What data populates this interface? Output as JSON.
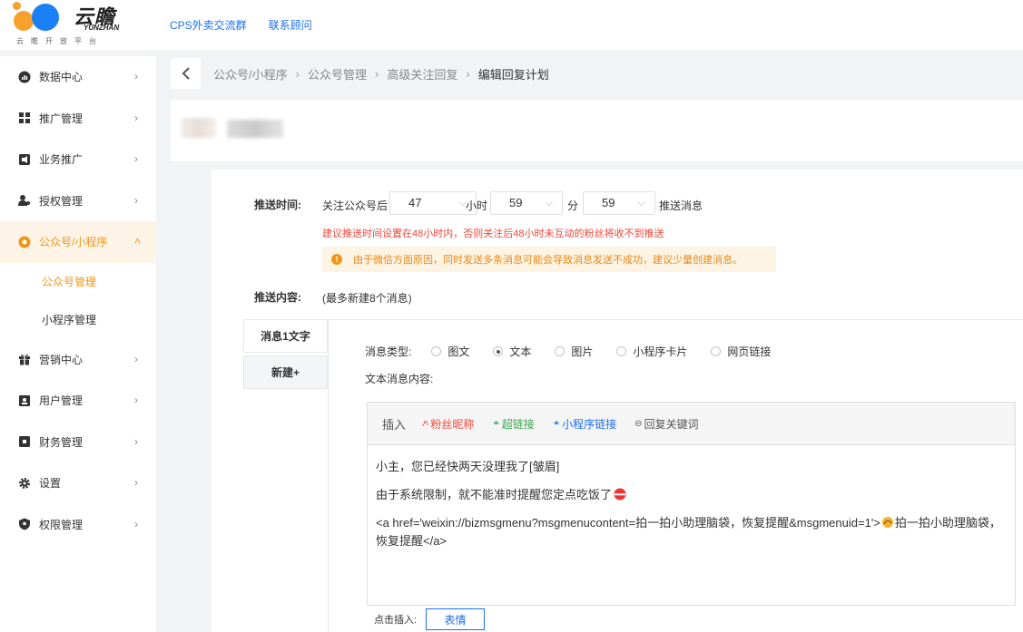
{
  "brand": {
    "name": "云瞻",
    "name_en": "YUNZHAN",
    "slogan": "云瞻开放平台"
  },
  "top_links": [
    "CPS外卖交流群",
    "联系顾问"
  ],
  "sidebar": {
    "items": [
      {
        "label": "数据中心",
        "icon": "chart-icon"
      },
      {
        "label": "推广管理",
        "icon": "grid-icon"
      },
      {
        "label": "业务推广",
        "icon": "megaphone-icon"
      },
      {
        "label": "授权管理",
        "icon": "user-key-icon"
      },
      {
        "label": "公众号/小程序",
        "icon": "wechat-circle-icon"
      },
      {
        "label": "营销中心",
        "icon": "gift-icon"
      },
      {
        "label": "用户管理",
        "icon": "user-card-icon"
      },
      {
        "label": "财务管理",
        "icon": "wallet-icon"
      },
      {
        "label": "设置",
        "icon": "gear-icon"
      },
      {
        "label": "权限管理",
        "icon": "shield-icon"
      }
    ],
    "subitems": [
      "公众号管理",
      "小程序管理"
    ]
  },
  "breadcrumb": [
    "公众号/小程序",
    "公众号管理",
    "高级关注回复",
    "编辑回复计划"
  ],
  "form": {
    "push_time_label": "推送时间:",
    "prefix": "关注公众号后",
    "hours": "47",
    "hours_unit": "小时",
    "minutes": "59",
    "minutes_unit": "分",
    "seconds": "59",
    "suffix": "推送消息",
    "red_tip": "建议推送时间设置在48小时内，否则关注后48小时未互动的粉丝将收不到推送",
    "notice": "由于微信方面原因，同时发送多条消息可能会导致消息发送不成功，建议少量创建消息。",
    "content_label": "推送内容:",
    "content_hint": "(最多新建8个消息)"
  },
  "tabs": [
    "消息1文字",
    "新建+"
  ],
  "message": {
    "type_label": "消息类型:",
    "types": [
      "图文",
      "文本",
      "图片",
      "小程序卡片",
      "网页链接"
    ],
    "selected_type": "文本",
    "text_label": "文本消息内容:"
  },
  "toolbar": {
    "insert": "插入",
    "fan_nickname": "粉丝昵称",
    "hyperlink": "超链接",
    "mini_link": "小程序链接",
    "reply_keyword": "回复关键词"
  },
  "editor": {
    "line1": "小主，您已经快两天没理我了[皱眉]",
    "line2": "由于系统限制，就不能准时提醒您定点吃饭了",
    "line3a": "<a href='weixin://bizmsgmenu?msgmenucontent=拍一拍小助理脑袋，恢复提醒&msgmenuid=1'>",
    "line3b": "拍一拍小助理脑袋，恢复提醒</a>"
  },
  "bottom": {
    "click_insert": "点击插入:",
    "emoji_button": "表情"
  },
  "colors": {
    "accent": "#f0961a",
    "link": "#1b6ff2",
    "warn_red": "#f0473b"
  }
}
